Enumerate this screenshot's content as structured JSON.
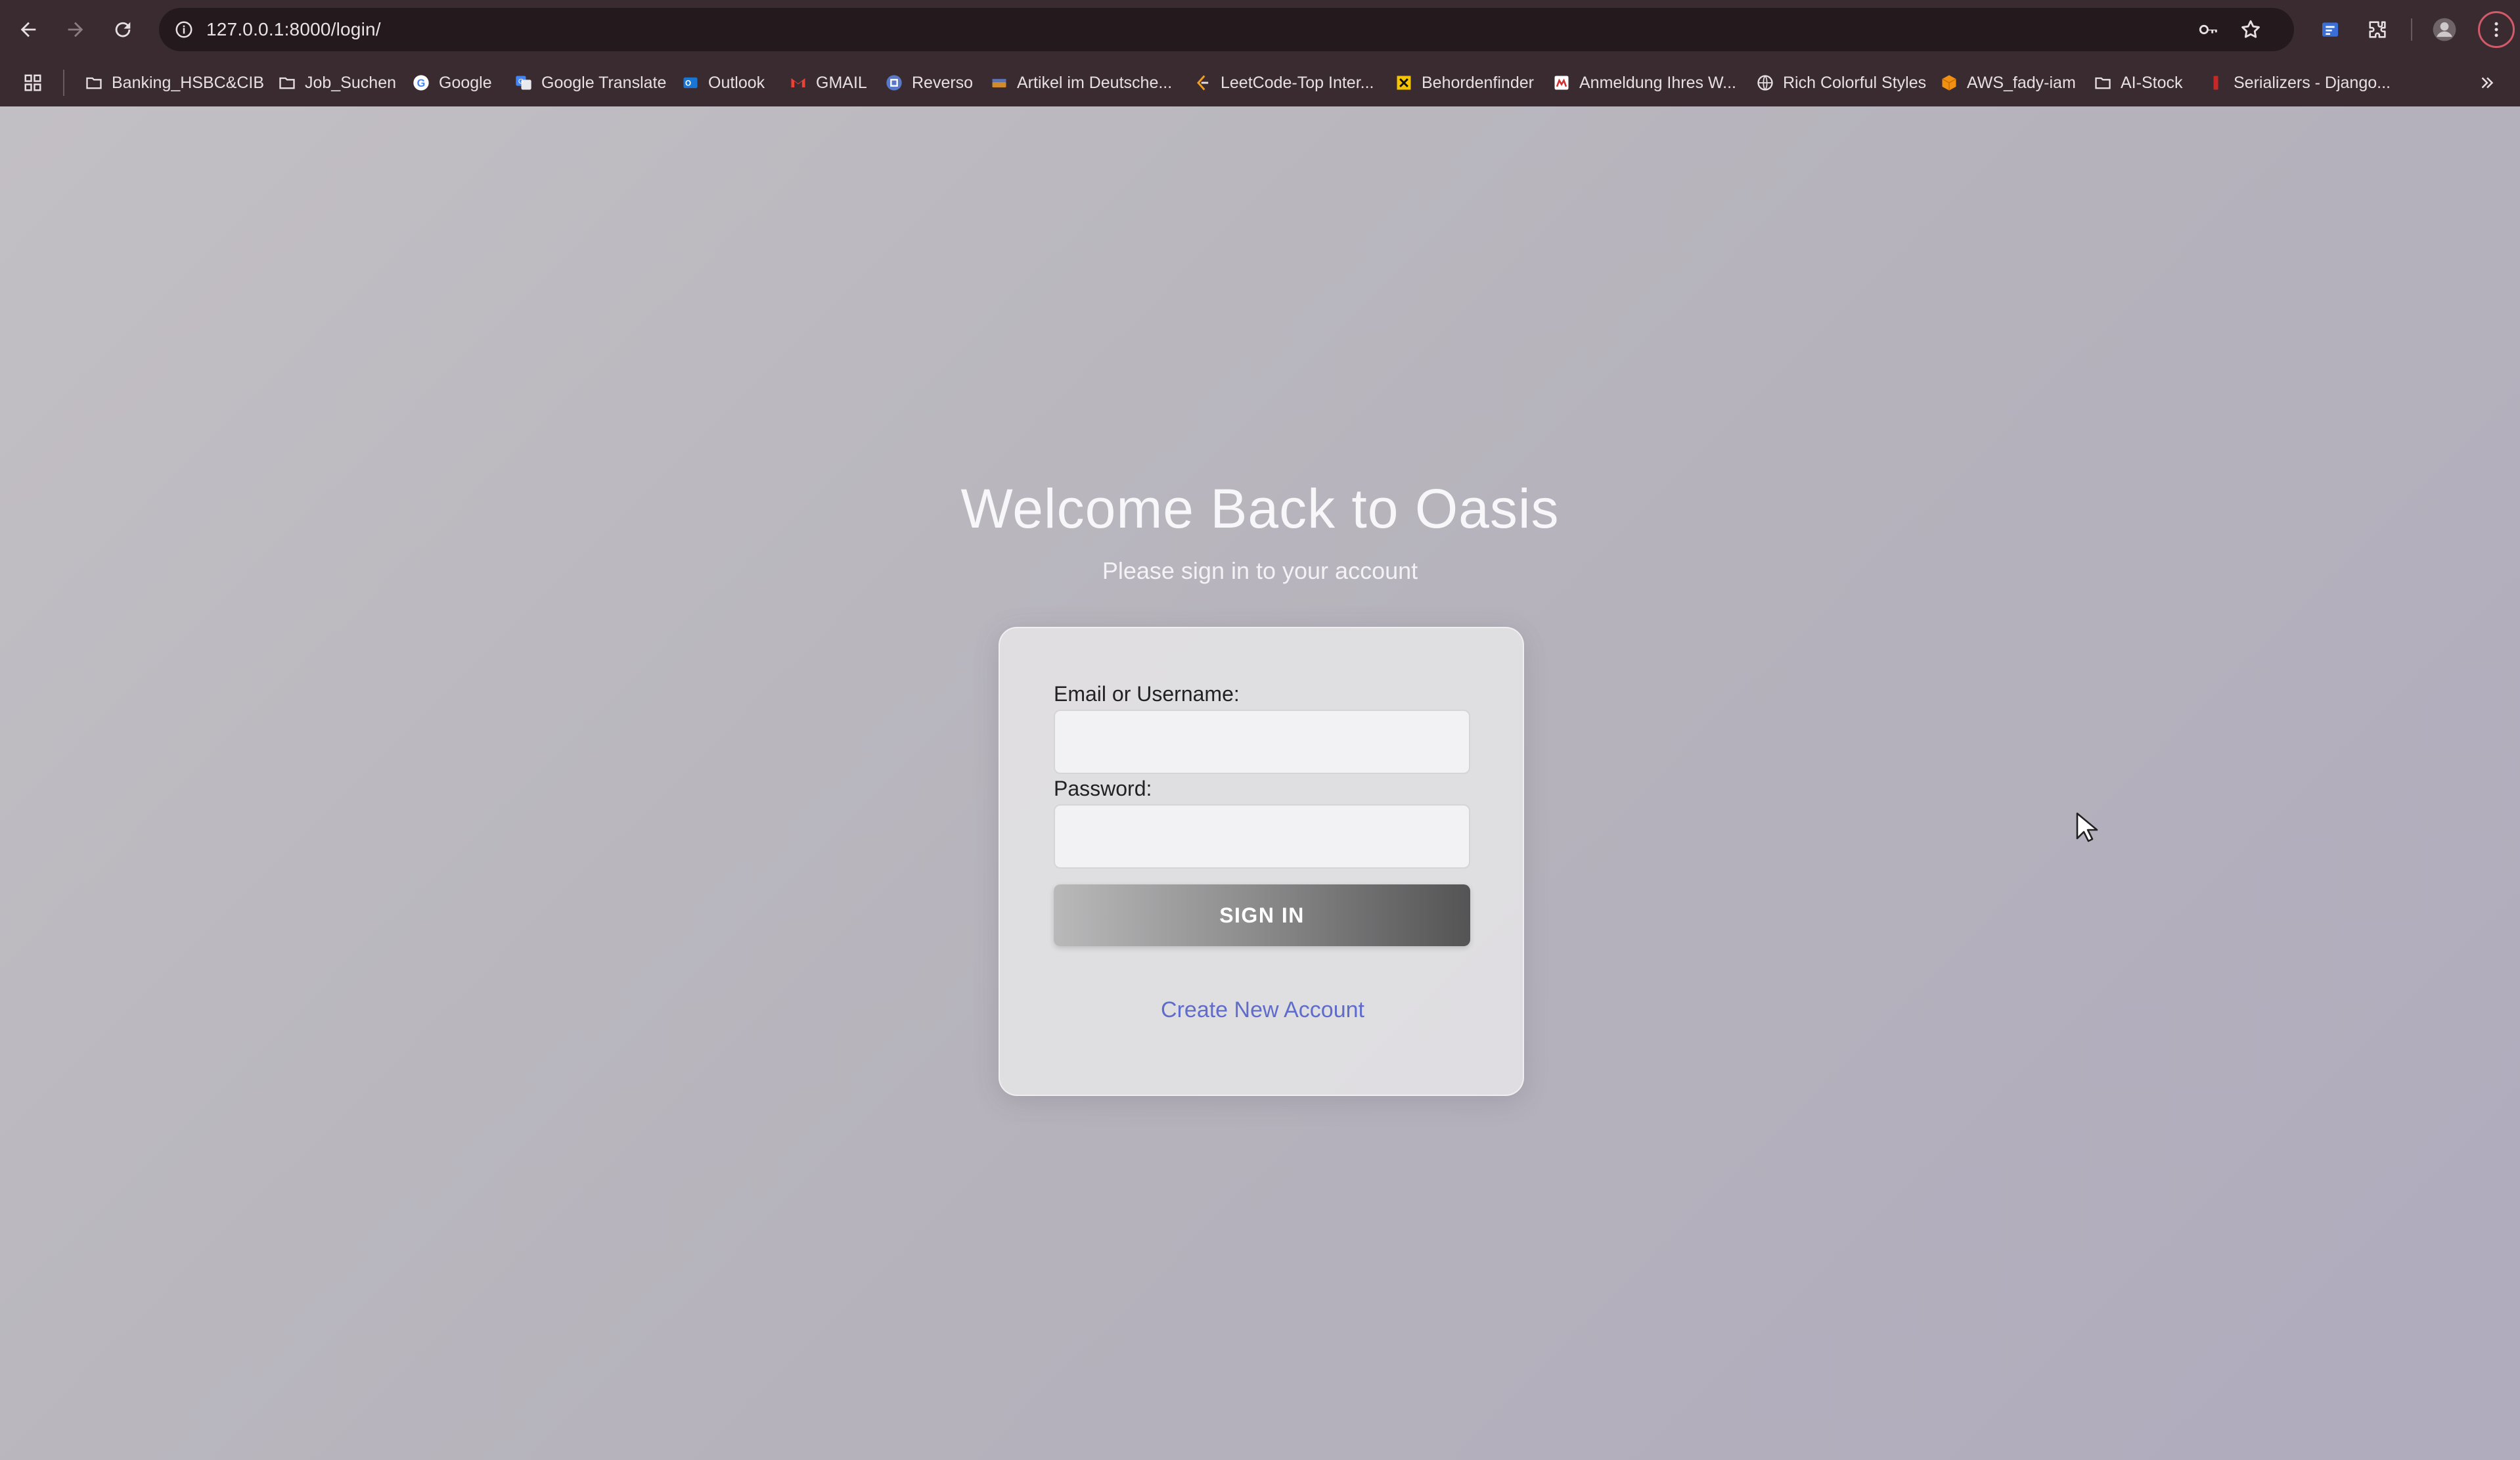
{
  "browser": {
    "url": "127.0.0.1:8000/login/",
    "bookmarks": [
      {
        "label": "Banking_HSBC&CIB",
        "icon": "folder-icon"
      },
      {
        "label": "Job_Suchen",
        "icon": "folder-icon"
      },
      {
        "label": "Google",
        "icon": "google-icon"
      },
      {
        "label": "Google Translate",
        "icon": "translate-icon"
      },
      {
        "label": "Outlook",
        "icon": "outlook-icon"
      },
      {
        "label": "GMAIL",
        "icon": "gmail-icon"
      },
      {
        "label": "Reverso",
        "icon": "reverso-icon"
      },
      {
        "label": "Artikel im Deutsche...",
        "icon": "dictionary-icon"
      },
      {
        "label": "LeetCode-Top Inter...",
        "icon": "leetcode-icon"
      },
      {
        "label": "Behordenfinder",
        "icon": "behordenfinder-icon"
      },
      {
        "label": "Anmeldung Ihres W...",
        "icon": "anmeldung-icon"
      },
      {
        "label": "Rich Colorful Styles",
        "icon": "globe-icon"
      },
      {
        "label": "AWS_fady-iam",
        "icon": "aws-icon"
      },
      {
        "label": "AI-Stock",
        "icon": "folder-icon"
      },
      {
        "label": "Serializers - Django...",
        "icon": "django-icon"
      }
    ]
  },
  "login": {
    "heading": "Welcome Back to Oasis",
    "subheading": "Please sign in to your account",
    "email_label": "Email or Username:",
    "email_value": "",
    "password_label": "Password:",
    "password_value": "",
    "signin_label": "SIGN IN",
    "create_account_label": "Create New Account"
  },
  "colors": {
    "chrome": "#3a2b30",
    "omnibox": "#241a1e",
    "page_bg": "#b9b6be",
    "link": "#5f6ccc",
    "button_dark": "#545455"
  }
}
